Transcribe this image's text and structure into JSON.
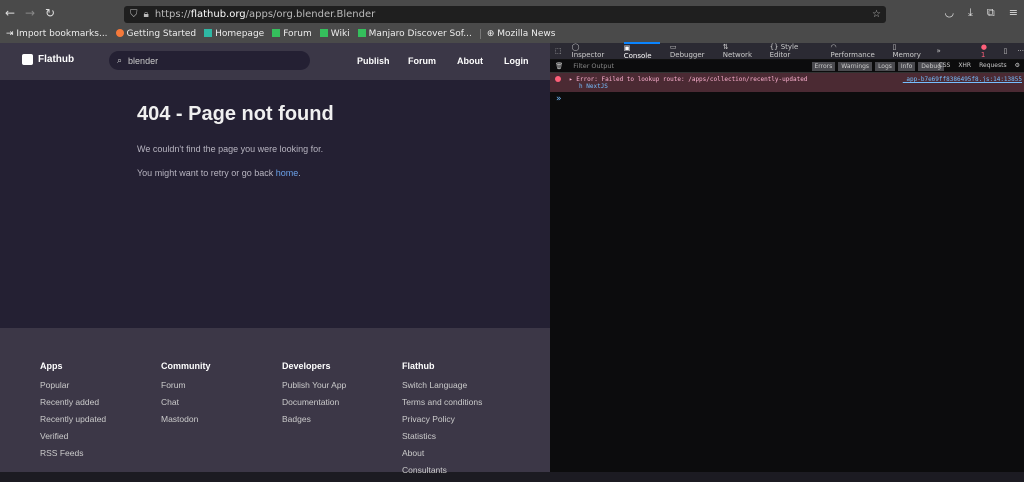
{
  "browser": {
    "url_prefix": "https://",
    "url_host": "flathub.org",
    "url_path": "/apps/org.blender.Blender",
    "bookmarks": [
      "Import bookmarks...",
      "Getting Started",
      "Homepage",
      "Forum",
      "Wiki",
      "Manjaro Discover Sof...",
      "Mozilla News"
    ]
  },
  "site": {
    "logo": "Flathub",
    "search_value": "blender",
    "nav": [
      "Publish",
      "Forum",
      "About",
      "Login"
    ],
    "title": "404 - Page not found",
    "message": "We couldn't find the page you were looking for.",
    "retry_pre": "You might want to retry or go back ",
    "retry_link": "home",
    "retry_post": ".",
    "footer": [
      {
        "heading": "Apps",
        "links": [
          "Popular",
          "Recently added",
          "Recently updated",
          "Verified",
          "RSS Feeds"
        ]
      },
      {
        "heading": "Community",
        "links": [
          "Forum",
          "Chat",
          "Mastodon"
        ]
      },
      {
        "heading": "Developers",
        "links": [
          "Publish Your App",
          "Documentation",
          "Badges"
        ]
      },
      {
        "heading": "Flathub",
        "links": [
          "Switch Language",
          "Terms and conditions",
          "Privacy Policy",
          "Statistics",
          "About",
          "Consultants"
        ]
      }
    ]
  },
  "devtools": {
    "tabs": [
      "Inspector",
      "Console",
      "Debugger",
      "Network",
      "Style Editor",
      "Performance",
      "Memory"
    ],
    "error_count": "1",
    "filter_placeholder": "Filter Output",
    "filters": [
      "Errors",
      "Warnings",
      "Logs",
      "Info",
      "Debug"
    ],
    "extra_filters": [
      "CSS",
      "XHR",
      "Requests"
    ],
    "error_message": "Error: Failed to lookup route: /apps/collection/recently-updated",
    "error_source": "_app-b7e69ff8386495f8.js:14:13855",
    "error_stack": "NextJS",
    "prompt": "»"
  }
}
